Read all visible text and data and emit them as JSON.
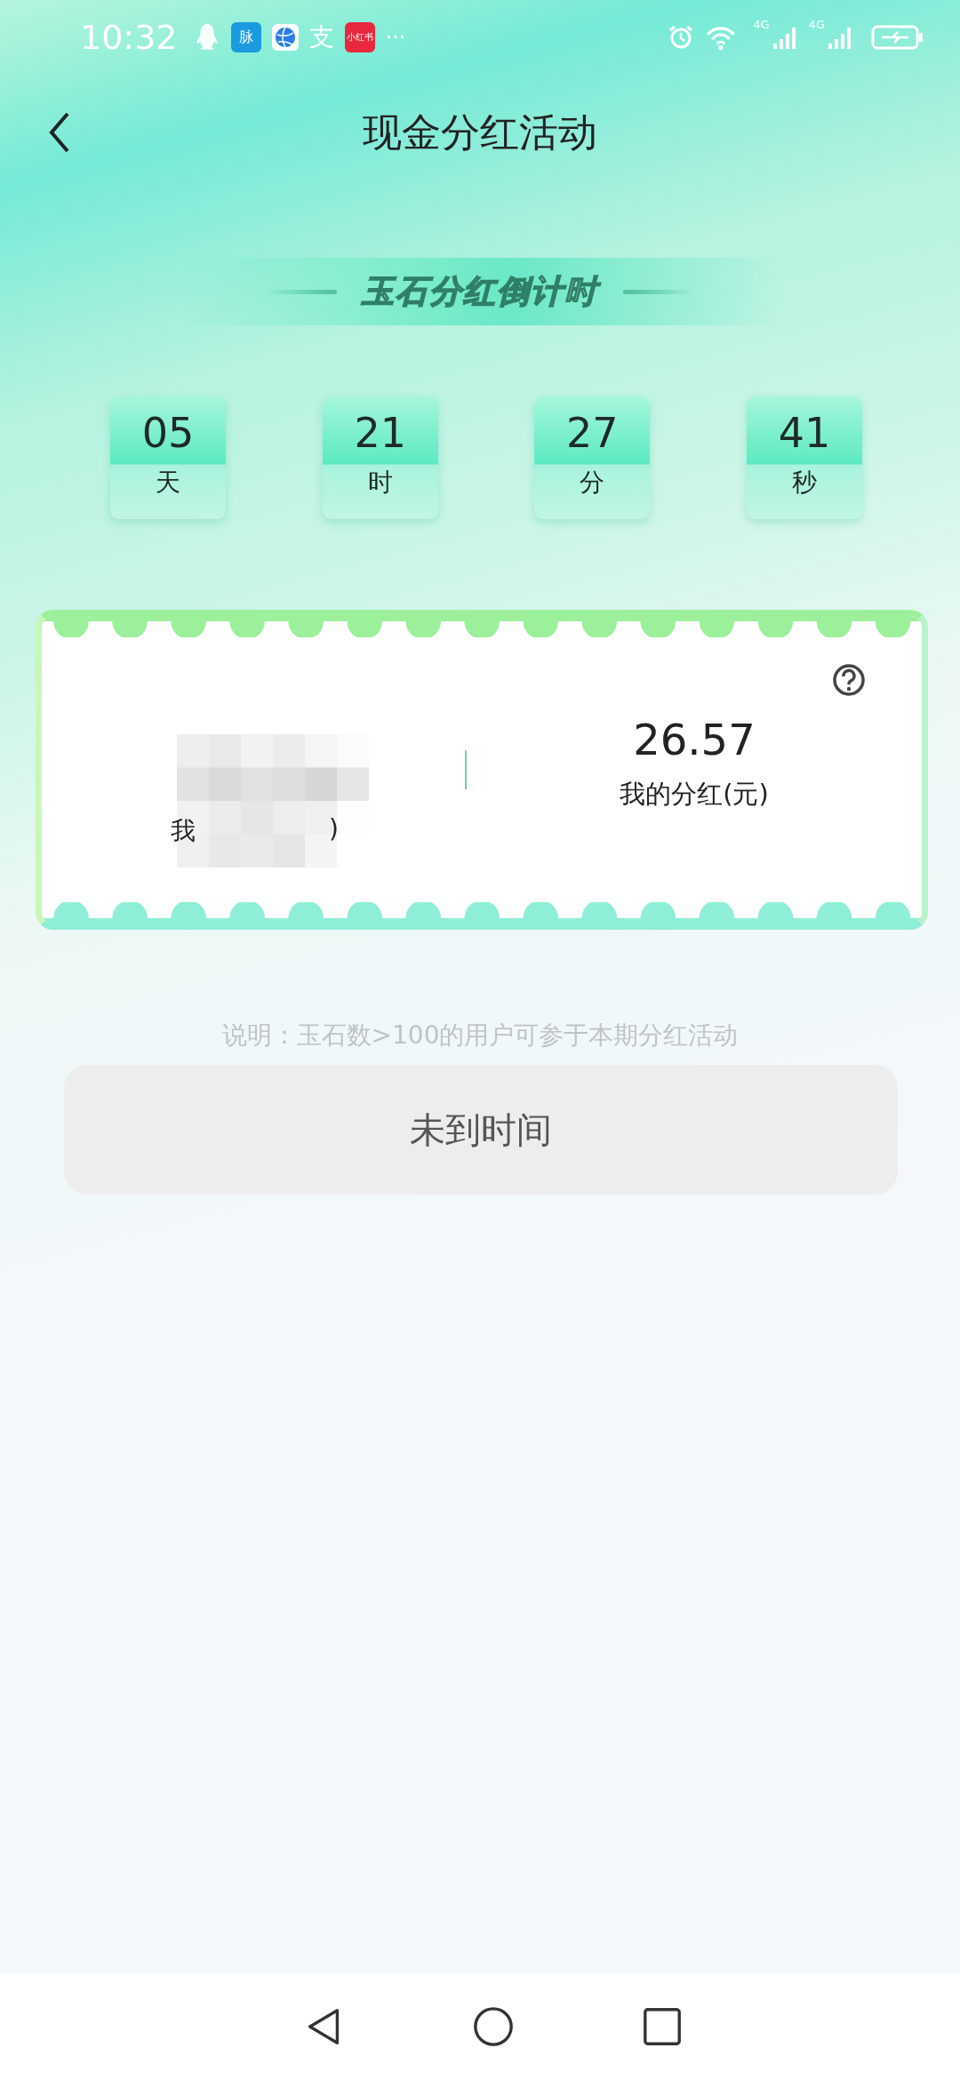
{
  "status_bar": {
    "time": "10:32",
    "app_icons": [
      {
        "kind": "penguin"
      },
      {
        "kind": "badge",
        "text": "脉",
        "color": "#1a9be0"
      },
      {
        "kind": "globe"
      },
      {
        "kind": "glyph",
        "text": "支"
      },
      {
        "kind": "badge",
        "text": "小红书",
        "color": "#e8283c"
      }
    ],
    "more": "···",
    "signals": [
      "4G",
      "4G"
    ]
  },
  "header": {
    "title": "现金分红活动"
  },
  "banner": {
    "title": "玉石分红倒计时"
  },
  "countdown": [
    {
      "value": "05",
      "unit": "天"
    },
    {
      "value": "21",
      "unit": "时"
    },
    {
      "value": "27",
      "unit": "分"
    },
    {
      "value": "41",
      "unit": "秒"
    }
  ],
  "card": {
    "left": {
      "label_start": "我",
      "label_end": ")"
    },
    "right": {
      "value": "26.57",
      "label": "我的分红(元)"
    }
  },
  "note": "说明：玉石数>100的用户可参于本期分红活动",
  "action_button": {
    "label": "未到时间",
    "disabled": true
  }
}
